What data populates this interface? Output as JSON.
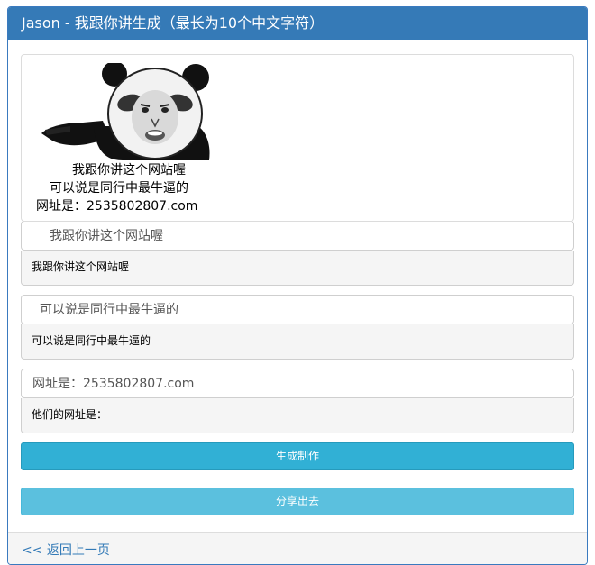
{
  "header": {
    "title": "Jason - 我跟你讲生成（最长为10个中文字符）"
  },
  "preview": {
    "lines": [
      "我跟你讲这个网站喔",
      "可以说是同行中最牛逼的",
      "网址是：2535802807.com"
    ]
  },
  "fields": [
    {
      "value": "",
      "placeholder": "我跟你讲这个网站喔",
      "echo": "我跟你讲这个网站喔"
    },
    {
      "value": "",
      "placeholder": "可以说是同行中最牛逼的",
      "echo": "可以说是同行中最牛逼的"
    },
    {
      "value": "",
      "placeholder": "网址是：2535802807.com",
      "echo": "他们的网址是："
    }
  ],
  "buttons": {
    "generate": "生成制作",
    "share": "分享出去"
  },
  "footer": {
    "back_link": "<< 返回上一页"
  },
  "colors": {
    "header": "#357ab7",
    "generate": "#31b0d5",
    "share": "#5bc0de",
    "link": "#337ab7"
  }
}
